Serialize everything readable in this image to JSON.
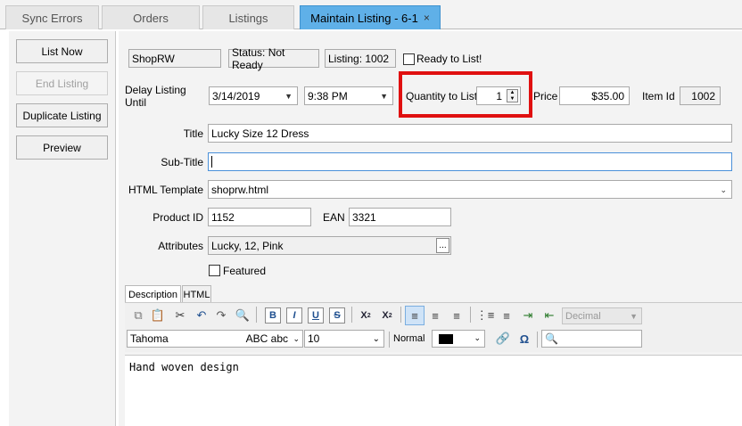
{
  "tabs": [
    {
      "label": "Sync Errors"
    },
    {
      "label": "Orders"
    },
    {
      "label": "Listings"
    },
    {
      "label": "Maintain Listing - 6-1",
      "close": "×"
    }
  ],
  "sidebar": {
    "list_now": "List Now",
    "end_listing": "End Listing",
    "duplicate_listing": "Duplicate Listing",
    "preview": "Preview"
  },
  "header": {
    "store": "ShopRW",
    "status": "Status: Not Ready",
    "listing": "Listing: 1002",
    "ready_label": "Ready to List!"
  },
  "delay": {
    "label": "Delay Listing Until",
    "date": "3/14/2019",
    "time": "9:38 PM"
  },
  "quantity": {
    "label": "Quantity to List",
    "value": "1"
  },
  "price": {
    "label": "Price",
    "value": "$35.00"
  },
  "item_id": {
    "label": "Item Id",
    "value": "1002"
  },
  "form": {
    "title_label": "Title",
    "title_value": "Lucky Size 12 Dress",
    "subtitle_label": "Sub-Title",
    "subtitle_value": "",
    "template_label": "HTML Template",
    "template_value": "shoprw.html",
    "product_id_label": "Product ID",
    "product_id_value": "1152",
    "ean_label": "EAN",
    "ean_value": "3321",
    "attributes_label": "Attributes",
    "attributes_value": "Lucky, 12, Pink",
    "attributes_btn": "...",
    "featured_label": "Featured"
  },
  "editor": {
    "tabs": [
      "Description",
      "HTML"
    ],
    "font_family": "Tahoma",
    "font_preview": "ABC abc",
    "font_size": "10",
    "style": "Normal",
    "list_type": "Decimal",
    "content": "Hand woven design"
  },
  "colors": {
    "accent_tab": "#5fb0e8",
    "highlight": "#e01010"
  }
}
